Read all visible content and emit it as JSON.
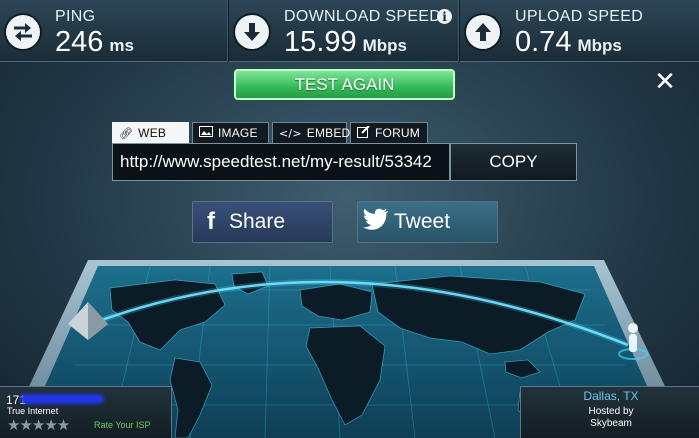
{
  "metrics": {
    "ping": {
      "label": "PING",
      "value": "246",
      "unit": "ms",
      "icon": "ping-arrows-icon"
    },
    "download": {
      "label": "DOWNLOAD SPEED",
      "value": "15.99",
      "unit": "Mbps",
      "icon": "download-arrow-icon"
    },
    "upload": {
      "label": "UPLOAD SPEED",
      "value": "0.74",
      "unit": "Mbps",
      "icon": "upload-arrow-icon"
    },
    "info_glyph": "i"
  },
  "actions": {
    "test_again": "TEST AGAIN",
    "close": "✕"
  },
  "share": {
    "tabs": [
      {
        "label": "WEB",
        "icon": "link-icon",
        "active": true
      },
      {
        "label": "IMAGE",
        "icon": "image-icon",
        "active": false
      },
      {
        "label": "EMBED",
        "icon": "code-icon",
        "active": false
      },
      {
        "label": "FORUM",
        "icon": "forum-icon",
        "active": false
      }
    ],
    "url": "http://www.speedtest.net/my-result/53342",
    "copy_label": "COPY",
    "facebook_label": "Share",
    "twitter_label": "Tweet"
  },
  "isp": {
    "ip": "171",
    "name": "True Internet",
    "stars": "★★★★★",
    "rate_label": "Rate Your ISP"
  },
  "server": {
    "city": "Dallas, TX",
    "hosted_by": "Hosted by",
    "host": "Skybeam"
  },
  "colors": {
    "accent_green": "#34b957",
    "city_blue": "#6ac6f0",
    "rate_green": "#66d05c",
    "map_glow": "#3ad4ff"
  }
}
